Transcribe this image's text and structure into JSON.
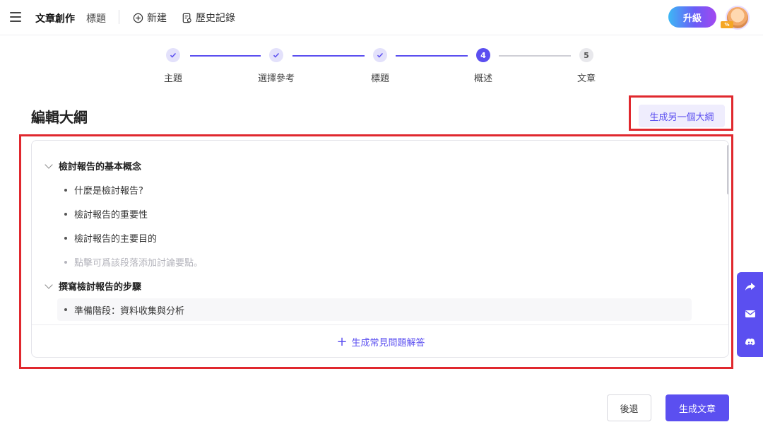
{
  "header": {
    "app_title": "文章創作",
    "nav_title": "標題",
    "new_label": "新建",
    "history_label": "歷史記錄",
    "upgrade_label": "升級",
    "avatar_badge": "%"
  },
  "stepper": {
    "current_step": 4,
    "steps": [
      {
        "number": "1",
        "label": "主題",
        "state": "done"
      },
      {
        "number": "2",
        "label": "選擇參考",
        "state": "done"
      },
      {
        "number": "3",
        "label": "標題",
        "state": "done"
      },
      {
        "number": "4",
        "label": "概述",
        "state": "active"
      },
      {
        "number": "5",
        "label": "文章",
        "state": "todo"
      }
    ]
  },
  "page": {
    "title": "編輯大綱",
    "regenerate_label": "生成另一個大綱"
  },
  "outline": {
    "sections": [
      {
        "title": "檢討報告的基本概念",
        "items": [
          "什麼是檢討報告?",
          "檢討報告的重要性",
          "檢討報告的主要目的"
        ],
        "placeholder": "點擊可爲該段落添加討論要點。"
      },
      {
        "title": "撰寫檢討報告的步驟",
        "items": [
          "準備階段：資料收集與分析"
        ]
      }
    ],
    "faq_label": "生成常見問題解答"
  },
  "actions": {
    "back_label": "後退",
    "generate_label": "生成文章"
  },
  "colors": {
    "accent": "#5b4ff0",
    "highlight_border": "#e0282e"
  },
  "icons": {
    "side": [
      "share-icon",
      "mail-icon",
      "discord-icon"
    ]
  }
}
